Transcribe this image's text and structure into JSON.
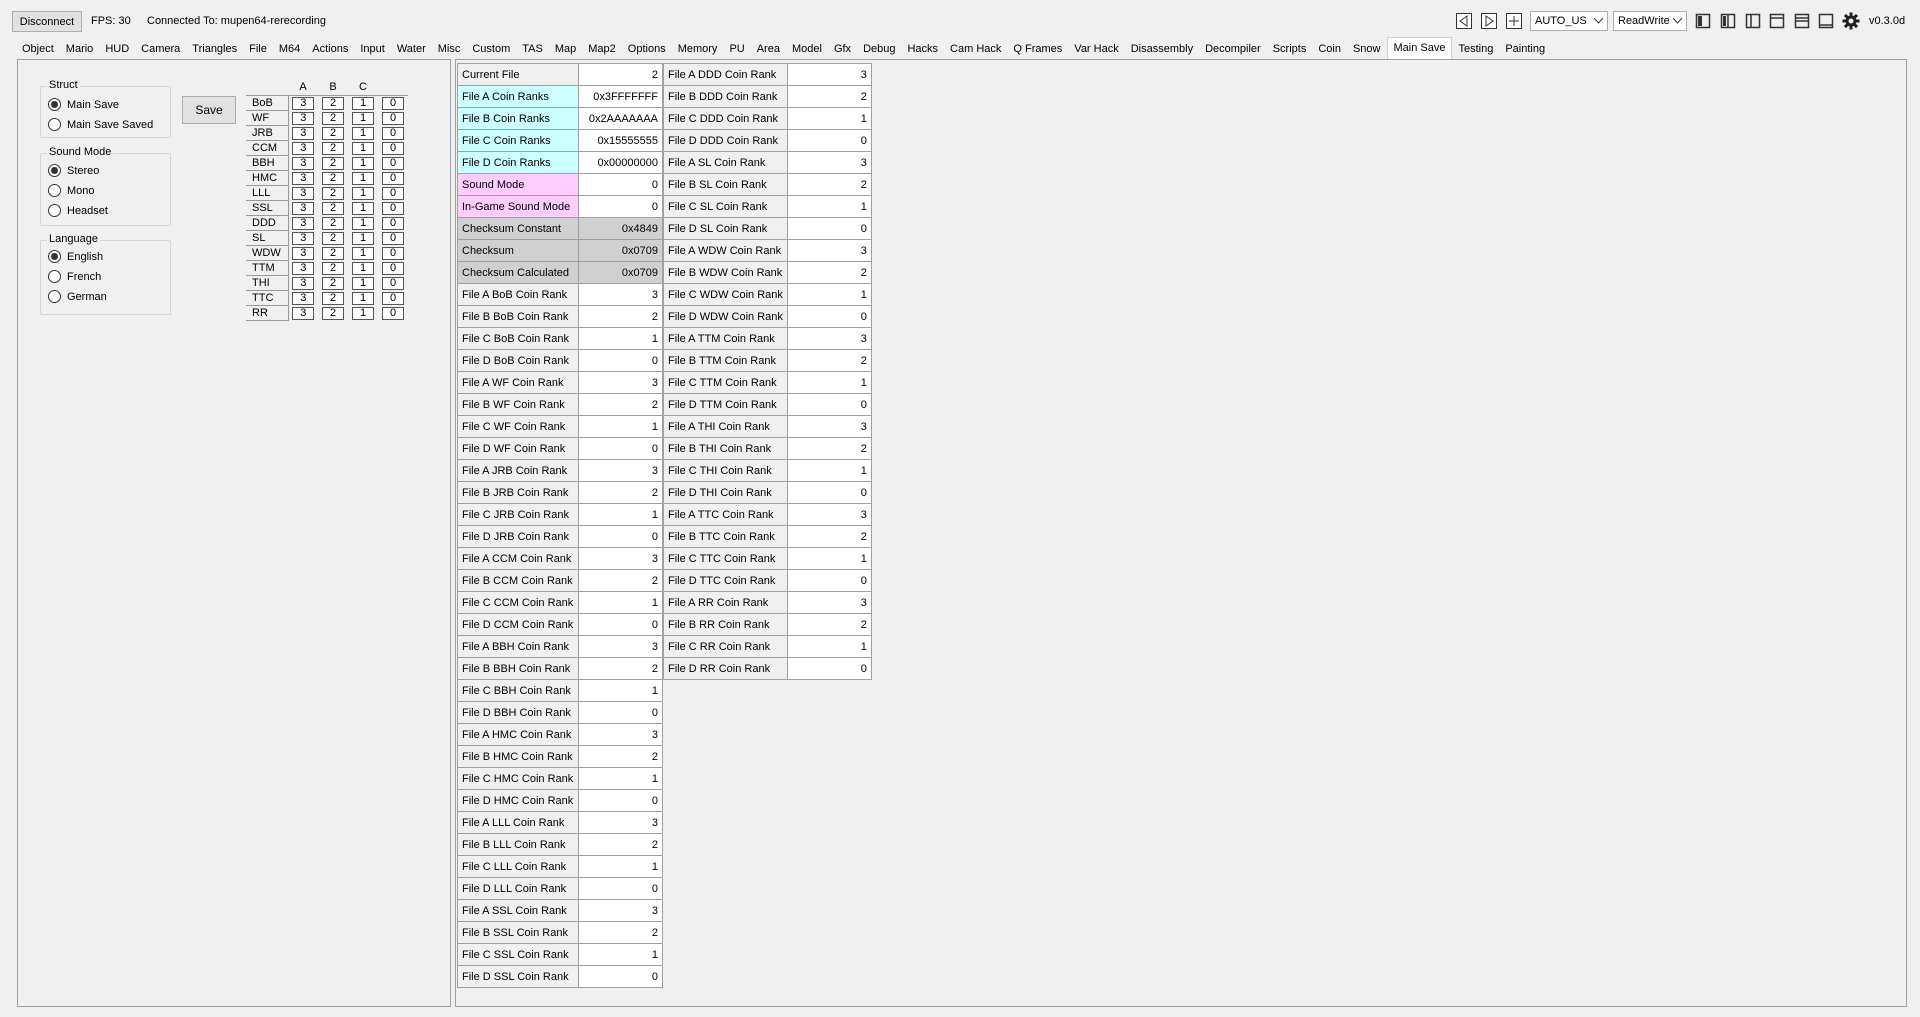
{
  "toolbar": {
    "disconnect_label": "Disconnect",
    "fps": "FPS: 30",
    "connection": "Connected To: mupen64-rerecording",
    "region_value": "AUTO_US",
    "mode_value": "ReadWrite",
    "version": "v0.3.0d"
  },
  "tabs": [
    "Object",
    "Mario",
    "HUD",
    "Camera",
    "Triangles",
    "File",
    "M64",
    "Actions",
    "Input",
    "Water",
    "Misc",
    "Custom",
    "TAS",
    "Map",
    "Map2",
    "Options",
    "Memory",
    "PU",
    "Area",
    "Model",
    "Gfx",
    "Debug",
    "Hacks",
    "Cam Hack",
    "Q Frames",
    "Var Hack",
    "Disassembly",
    "Decompiler",
    "Scripts",
    "Coin",
    "Snow",
    "Main Save",
    "Testing",
    "Painting"
  ],
  "active_tab": "Main Save",
  "struct": {
    "title": "Struct",
    "options": [
      "Main Save",
      "Main Save Saved"
    ],
    "selected": 0
  },
  "sound_mode": {
    "title": "Sound Mode",
    "options": [
      "Stereo",
      "Mono",
      "Headset"
    ],
    "selected": 0
  },
  "language": {
    "title": "Language",
    "options": [
      "English",
      "French",
      "German"
    ],
    "selected": 0
  },
  "save_label": "Save",
  "rank_table": {
    "columns": [
      "A",
      "B",
      "C",
      ""
    ],
    "rows": [
      {
        "label": "BoB",
        "values": [
          "3",
          "2",
          "1",
          "0"
        ]
      },
      {
        "label": "WF",
        "values": [
          "3",
          "2",
          "1",
          "0"
        ]
      },
      {
        "label": "JRB",
        "values": [
          "3",
          "2",
          "1",
          "0"
        ]
      },
      {
        "label": "CCM",
        "values": [
          "3",
          "2",
          "1",
          "0"
        ]
      },
      {
        "label": "BBH",
        "values": [
          "3",
          "2",
          "1",
          "0"
        ]
      },
      {
        "label": "HMC",
        "values": [
          "3",
          "2",
          "1",
          "0"
        ]
      },
      {
        "label": "LLL",
        "values": [
          "3",
          "2",
          "1",
          "0"
        ]
      },
      {
        "label": "SSL",
        "values": [
          "3",
          "2",
          "1",
          "0"
        ]
      },
      {
        "label": "DDD",
        "values": [
          "3",
          "2",
          "1",
          "0"
        ]
      },
      {
        "label": "SL",
        "values": [
          "3",
          "2",
          "1",
          "0"
        ]
      },
      {
        "label": "WDW",
        "values": [
          "3",
          "2",
          "1",
          "0"
        ]
      },
      {
        "label": "TTM",
        "values": [
          "3",
          "2",
          "1",
          "0"
        ]
      },
      {
        "label": "THI",
        "values": [
          "3",
          "2",
          "1",
          "0"
        ]
      },
      {
        "label": "TTC",
        "values": [
          "3",
          "2",
          "1",
          "0"
        ]
      },
      {
        "label": "RR",
        "values": [
          "3",
          "2",
          "1",
          "0"
        ]
      }
    ]
  },
  "var_col1": [
    {
      "name": "Current File",
      "value": "2",
      "style": ""
    },
    {
      "name": "File A Coin Ranks",
      "value": "0x3FFFFFFF",
      "style": "cyan"
    },
    {
      "name": "File B Coin Ranks",
      "value": "0x2AAAAAAA",
      "style": "cyan"
    },
    {
      "name": "File C Coin Ranks",
      "value": "0x15555555",
      "style": "cyan"
    },
    {
      "name": "File D Coin Ranks",
      "value": "0x00000000",
      "style": "cyan"
    },
    {
      "name": "Sound Mode",
      "value": "0",
      "style": "pink"
    },
    {
      "name": "In-Game Sound Mode",
      "value": "0",
      "style": "pink"
    },
    {
      "name": "Checksum Constant",
      "value": "0x4849",
      "style": "gray"
    },
    {
      "name": "Checksum",
      "value": "0x0709",
      "style": "gray"
    },
    {
      "name": "Checksum Calculated",
      "value": "0x0709",
      "style": "gray"
    },
    {
      "name": "File A BoB Coin Rank",
      "value": "3",
      "style": ""
    },
    {
      "name": "File B BoB Coin Rank",
      "value": "2",
      "style": ""
    },
    {
      "name": "File C BoB Coin Rank",
      "value": "1",
      "style": ""
    },
    {
      "name": "File D BoB Coin Rank",
      "value": "0",
      "style": ""
    },
    {
      "name": "File A WF Coin Rank",
      "value": "3",
      "style": ""
    },
    {
      "name": "File B WF Coin Rank",
      "value": "2",
      "style": ""
    },
    {
      "name": "File C WF Coin Rank",
      "value": "1",
      "style": ""
    },
    {
      "name": "File D WF Coin Rank",
      "value": "0",
      "style": ""
    },
    {
      "name": "File A JRB Coin Rank",
      "value": "3",
      "style": ""
    },
    {
      "name": "File B JRB Coin Rank",
      "value": "2",
      "style": ""
    },
    {
      "name": "File C JRB Coin Rank",
      "value": "1",
      "style": ""
    },
    {
      "name": "File D JRB Coin Rank",
      "value": "0",
      "style": ""
    },
    {
      "name": "File A CCM Coin Rank",
      "value": "3",
      "style": ""
    },
    {
      "name": "File B CCM Coin Rank",
      "value": "2",
      "style": ""
    },
    {
      "name": "File C CCM Coin Rank",
      "value": "1",
      "style": ""
    },
    {
      "name": "File D CCM Coin Rank",
      "value": "0",
      "style": ""
    },
    {
      "name": "File A BBH Coin Rank",
      "value": "3",
      "style": ""
    },
    {
      "name": "File B BBH Coin Rank",
      "value": "2",
      "style": ""
    },
    {
      "name": "File C BBH Coin Rank",
      "value": "1",
      "style": ""
    },
    {
      "name": "File D BBH Coin Rank",
      "value": "0",
      "style": ""
    },
    {
      "name": "File A HMC Coin Rank",
      "value": "3",
      "style": ""
    },
    {
      "name": "File B HMC Coin Rank",
      "value": "2",
      "style": ""
    },
    {
      "name": "File C HMC Coin Rank",
      "value": "1",
      "style": ""
    },
    {
      "name": "File D HMC Coin Rank",
      "value": "0",
      "style": ""
    },
    {
      "name": "File A LLL Coin Rank",
      "value": "3",
      "style": ""
    },
    {
      "name": "File B LLL Coin Rank",
      "value": "2",
      "style": ""
    },
    {
      "name": "File C LLL Coin Rank",
      "value": "1",
      "style": ""
    },
    {
      "name": "File D LLL Coin Rank",
      "value": "0",
      "style": ""
    },
    {
      "name": "File A SSL Coin Rank",
      "value": "3",
      "style": ""
    },
    {
      "name": "File B SSL Coin Rank",
      "value": "2",
      "style": ""
    },
    {
      "name": "File C SSL Coin Rank",
      "value": "1",
      "style": ""
    },
    {
      "name": "File D SSL Coin Rank",
      "value": "0",
      "style": ""
    }
  ],
  "var_col2": [
    {
      "name": "File A DDD Coin Rank",
      "value": "3",
      "style": ""
    },
    {
      "name": "File B DDD Coin Rank",
      "value": "2",
      "style": ""
    },
    {
      "name": "File C DDD Coin Rank",
      "value": "1",
      "style": ""
    },
    {
      "name": "File D DDD Coin Rank",
      "value": "0",
      "style": ""
    },
    {
      "name": "File A SL Coin Rank",
      "value": "3",
      "style": ""
    },
    {
      "name": "File B SL Coin Rank",
      "value": "2",
      "style": ""
    },
    {
      "name": "File C SL Coin Rank",
      "value": "1",
      "style": ""
    },
    {
      "name": "File D SL Coin Rank",
      "value": "0",
      "style": ""
    },
    {
      "name": "File A WDW Coin Rank",
      "value": "3",
      "style": ""
    },
    {
      "name": "File B WDW Coin Rank",
      "value": "2",
      "style": ""
    },
    {
      "name": "File C WDW Coin Rank",
      "value": "1",
      "style": ""
    },
    {
      "name": "File D WDW Coin Rank",
      "value": "0",
      "style": ""
    },
    {
      "name": "File A TTM Coin Rank",
      "value": "3",
      "style": ""
    },
    {
      "name": "File B TTM Coin Rank",
      "value": "2",
      "style": ""
    },
    {
      "name": "File C TTM Coin Rank",
      "value": "1",
      "style": ""
    },
    {
      "name": "File D TTM Coin Rank",
      "value": "0",
      "style": ""
    },
    {
      "name": "File A THI Coin Rank",
      "value": "3",
      "style": ""
    },
    {
      "name": "File B THI Coin Rank",
      "value": "2",
      "style": ""
    },
    {
      "name": "File C THI Coin Rank",
      "value": "1",
      "style": ""
    },
    {
      "name": "File D THI Coin Rank",
      "value": "0",
      "style": ""
    },
    {
      "name": "File A TTC Coin Rank",
      "value": "3",
      "style": ""
    },
    {
      "name": "File B TTC Coin Rank",
      "value": "2",
      "style": ""
    },
    {
      "name": "File C TTC Coin Rank",
      "value": "1",
      "style": ""
    },
    {
      "name": "File D TTC Coin Rank",
      "value": "0",
      "style": ""
    },
    {
      "name": "File A RR Coin Rank",
      "value": "3",
      "style": ""
    },
    {
      "name": "File B RR Coin Rank",
      "value": "2",
      "style": ""
    },
    {
      "name": "File C RR Coin Rank",
      "value": "1",
      "style": ""
    },
    {
      "name": "File D RR Coin Rank",
      "value": "0",
      "style": ""
    }
  ]
}
